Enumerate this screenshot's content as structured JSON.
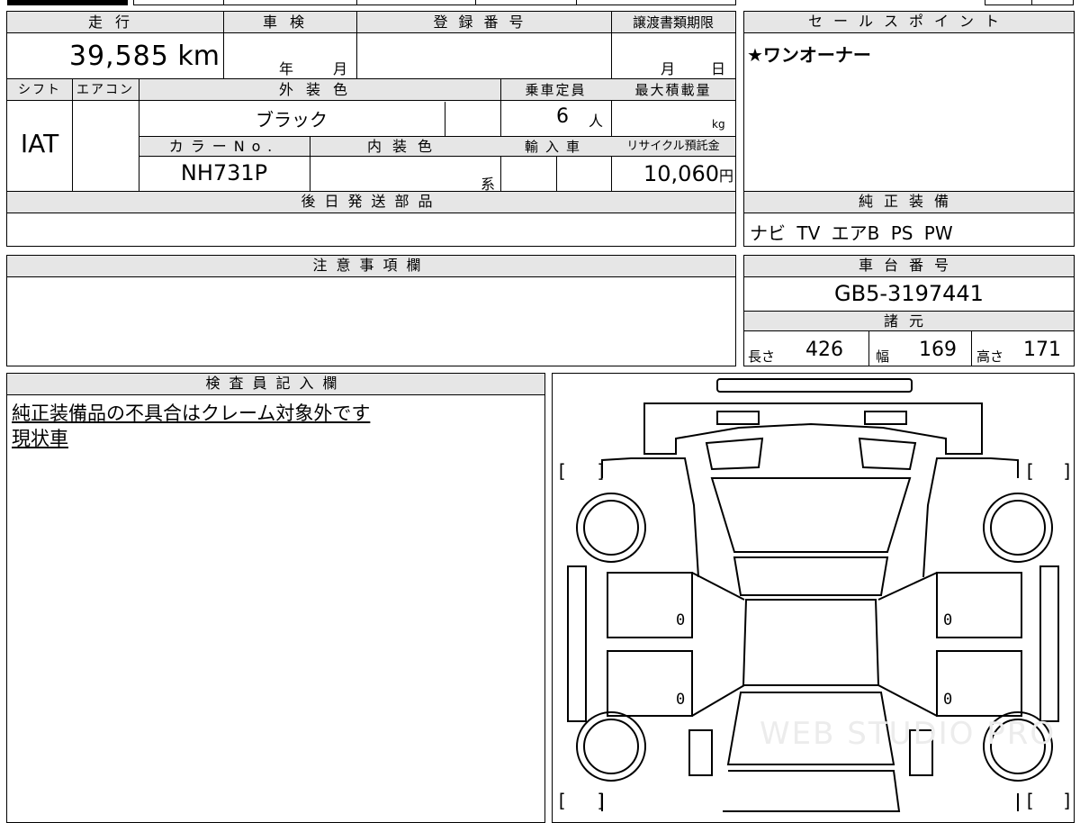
{
  "mileage": {
    "label": "走行",
    "value": "39,585",
    "unit": "km"
  },
  "inspection": {
    "label": "車検",
    "year_label": "年",
    "month_label": "月"
  },
  "registration": {
    "label": "登録番号"
  },
  "transfer_deadline": {
    "label": "譲渡書類期限",
    "month_label": "月",
    "day_label": "日"
  },
  "shift": {
    "label": "シフト",
    "value": "IAT"
  },
  "aircon": {
    "label": "エアコン"
  },
  "exterior_color": {
    "label": "外装色",
    "value": "ブラック"
  },
  "capacity": {
    "label": "乗車定員",
    "value": "6",
    "unit": "人"
  },
  "max_load": {
    "label": "最大積載量",
    "unit": "kg"
  },
  "color_no": {
    "label": "カラーNo.",
    "value": "NH731P"
  },
  "interior_color": {
    "label": "内装色",
    "suffix": "系"
  },
  "import": {
    "label": "輸入車"
  },
  "recycle": {
    "label": "リサイクル預託金",
    "value": "10,060",
    "unit": "円"
  },
  "later_parts": {
    "label": "後日発送部品"
  },
  "notes": {
    "label": "注意事項欄"
  },
  "inspector": {
    "label": "検査員記入欄",
    "line1": "純正装備品の不具合はクレーム対象外です",
    "line2": "現状車"
  },
  "sales_point": {
    "label": "セールスポイント",
    "value": "★ワンオーナー"
  },
  "equipment": {
    "label": "純正装備",
    "value": "ナビ TV エアB PS PW"
  },
  "chassis": {
    "label": "車台番号",
    "value": "GB5-3197441"
  },
  "specs": {
    "label": "諸元",
    "length_label": "長さ",
    "length": "426",
    "width_label": "幅",
    "width": "169",
    "height_label": "高さ",
    "height": "171"
  },
  "diagram": {
    "marks": [
      "0",
      "0",
      "0",
      "0"
    ],
    "bracket_left": "[",
    "bracket_right": "]",
    "watermark": "WEB STUDIO PRO"
  }
}
